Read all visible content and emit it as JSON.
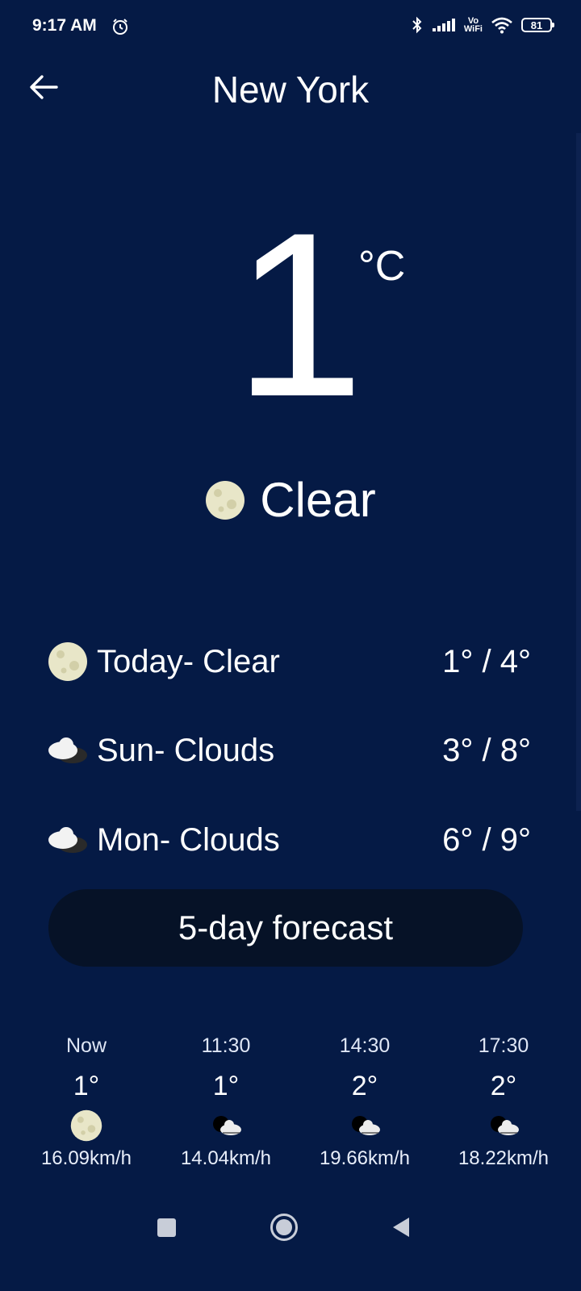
{
  "status_bar": {
    "time": "9:17 AM",
    "vowifi_top": "Vo",
    "vowifi_bottom": "WiFi",
    "battery": "81"
  },
  "header": {
    "city": "New York"
  },
  "current": {
    "temperature": "1",
    "unit": "°C",
    "condition": "Clear",
    "condition_icon": "moon-icon"
  },
  "daily": [
    {
      "label": "Today- Clear",
      "range": "1° / 4°",
      "icon": "moon-icon"
    },
    {
      "label": "Sun- Clouds",
      "range": "3° / 8°",
      "icon": "clouds-icon"
    },
    {
      "label": "Mon- Clouds",
      "range": "6° / 9°",
      "icon": "clouds-icon"
    }
  ],
  "forecast_button": "5-day forecast",
  "hourly": [
    {
      "time": "Now",
      "temp": "1°",
      "wind": "16.09km/h",
      "icon": "moon-icon"
    },
    {
      "time": "11:30",
      "temp": "1°",
      "wind": "14.04km/h",
      "icon": "partly-cloudy-night-icon"
    },
    {
      "time": "14:30",
      "temp": "2°",
      "wind": "19.66km/h",
      "icon": "partly-cloudy-night-icon"
    },
    {
      "time": "17:30",
      "temp": "2°",
      "wind": "18.22km/h",
      "icon": "partly-cloudy-night-icon"
    }
  ],
  "colors": {
    "background": "#051a45",
    "button": "#061227",
    "text": "#ffffff"
  }
}
